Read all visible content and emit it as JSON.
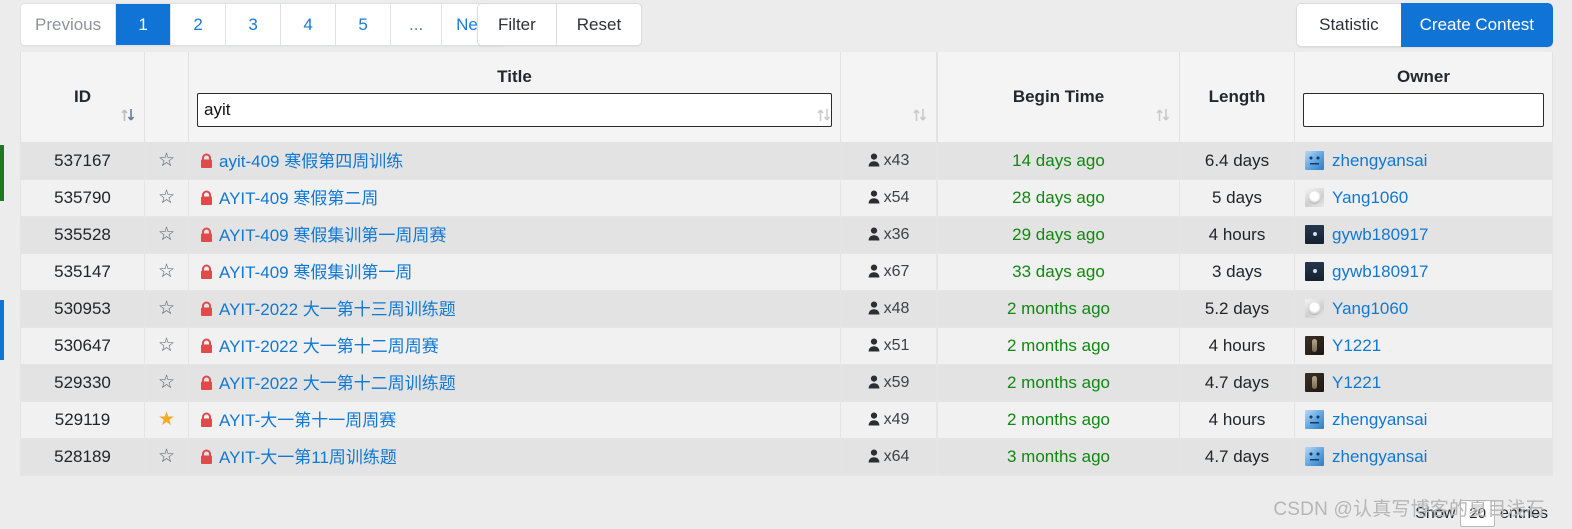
{
  "toolbar": {
    "pagination": [
      {
        "label": "Previous",
        "state": "muted"
      },
      {
        "label": "1",
        "state": "active"
      },
      {
        "label": "2",
        "state": "normal"
      },
      {
        "label": "3",
        "state": "normal"
      },
      {
        "label": "4",
        "state": "normal"
      },
      {
        "label": "5",
        "state": "normal"
      },
      {
        "label": "...",
        "state": "ellipsis"
      },
      {
        "label": "Next",
        "state": "normal"
      }
    ],
    "filter_label": "Filter",
    "reset_label": "Reset",
    "statistic_label": "Statistic",
    "create_contest_label": "Create Contest"
  },
  "table": {
    "headers": {
      "id": "ID",
      "star": "",
      "title": "Title",
      "count": "",
      "begin_time": "Begin Time",
      "length": "Length",
      "owner": "Owner"
    },
    "filters": {
      "title_value": "ayit",
      "title_placeholder": "",
      "owner_value": "",
      "owner_placeholder": ""
    },
    "sort_icon_name": "sort-updown-icon",
    "rows": [
      {
        "id": "537167",
        "starred": false,
        "locked": true,
        "title": "ayit-409 寒假第四周训练",
        "count": "x43",
        "begin_time": "14 days ago",
        "length": "6.4 days",
        "owner": "zhengyansai",
        "avatar": "av-face"
      },
      {
        "id": "535790",
        "starred": false,
        "locked": true,
        "title": "AYIT-409 寒假第二周",
        "count": "x54",
        "begin_time": "28 days ago",
        "length": "5 days",
        "owner": "Yang1060",
        "avatar": "av-sketch"
      },
      {
        "id": "535528",
        "starred": false,
        "locked": true,
        "title": "AYIT-409 寒假集训第一周周赛",
        "count": "x36",
        "begin_time": "29 days ago",
        "length": "4 hours",
        "owner": "gywb180917",
        "avatar": "av-night"
      },
      {
        "id": "535147",
        "starred": false,
        "locked": true,
        "title": "AYIT-409 寒假集训第一周",
        "count": "x67",
        "begin_time": "33 days ago",
        "length": "3 days",
        "owner": "gywb180917",
        "avatar": "av-night"
      },
      {
        "id": "530953",
        "starred": false,
        "locked": true,
        "title": "AYIT-2022 大一第十三周训练题",
        "count": "x48",
        "begin_time": "2 months ago",
        "length": "5.2 days",
        "owner": "Yang1060",
        "avatar": "av-sketch"
      },
      {
        "id": "530647",
        "starred": false,
        "locked": true,
        "title": "AYIT-2022 大一第十二周周赛",
        "count": "x51",
        "begin_time": "2 months ago",
        "length": "4 hours",
        "owner": "Y1221",
        "avatar": "av-dark"
      },
      {
        "id": "529330",
        "starred": false,
        "locked": true,
        "title": "AYIT-2022 大一第十二周训练题",
        "count": "x59",
        "begin_time": "2 months ago",
        "length": "4.7 days",
        "owner": "Y1221",
        "avatar": "av-dark"
      },
      {
        "id": "529119",
        "starred": true,
        "locked": true,
        "title": "AYIT-大一第十一周周赛",
        "count": "x49",
        "begin_time": "2 months ago",
        "length": "4 hours",
        "owner": "zhengyansai",
        "avatar": "av-face"
      },
      {
        "id": "528189",
        "starred": false,
        "locked": true,
        "title": "AYIT-大一第11周训练题",
        "count": "x64",
        "begin_time": "3 months ago",
        "length": "4.7 days",
        "owner": "zhengyansai",
        "avatar": "av-face"
      }
    ]
  },
  "footer": {
    "show_label": "Show",
    "entries_value": "20",
    "entries_label": "entries",
    "watermark": "CSDN @认真写博客的夏目浅石"
  },
  "colors": {
    "accent": "#1073d6",
    "link": "#1178d4",
    "time": "#128712",
    "lock": "#e2494a",
    "star_filled": "#f0ad21",
    "edge_green": "#1f7a1f"
  }
}
